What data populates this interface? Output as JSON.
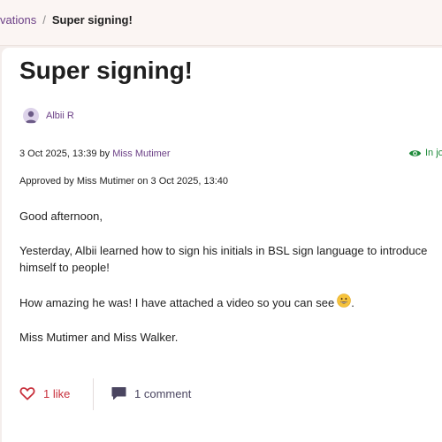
{
  "breadcrumb": {
    "parent": "vations",
    "separator": "/",
    "current": "Super signing!"
  },
  "post": {
    "title": "Super signing!",
    "child_name": "Albii R",
    "date": "3 Oct 2025, 13:39",
    "by": " by ",
    "author": "Miss Mutimer",
    "visibility": "In jo",
    "approved": "Approved by Miss Mutimer on 3 Oct 2025, 13:40",
    "paragraphs": [
      "Good afternoon,",
      "Yesterday, Albii learned how to sign his initials in BSL sign language to introduce himself to people!",
      "How amazing he was! I have attached a video so you can see",
      "Miss Mutimer and Miss Walker."
    ],
    "emoji_suffix": "."
  },
  "actions": {
    "like_label": "1 like",
    "comment_label": "1 comment"
  },
  "colors": {
    "accent": "#6b3f86",
    "like": "#c8303c",
    "visibility": "#1e8a3a",
    "comment_icon": "#4a4560"
  }
}
